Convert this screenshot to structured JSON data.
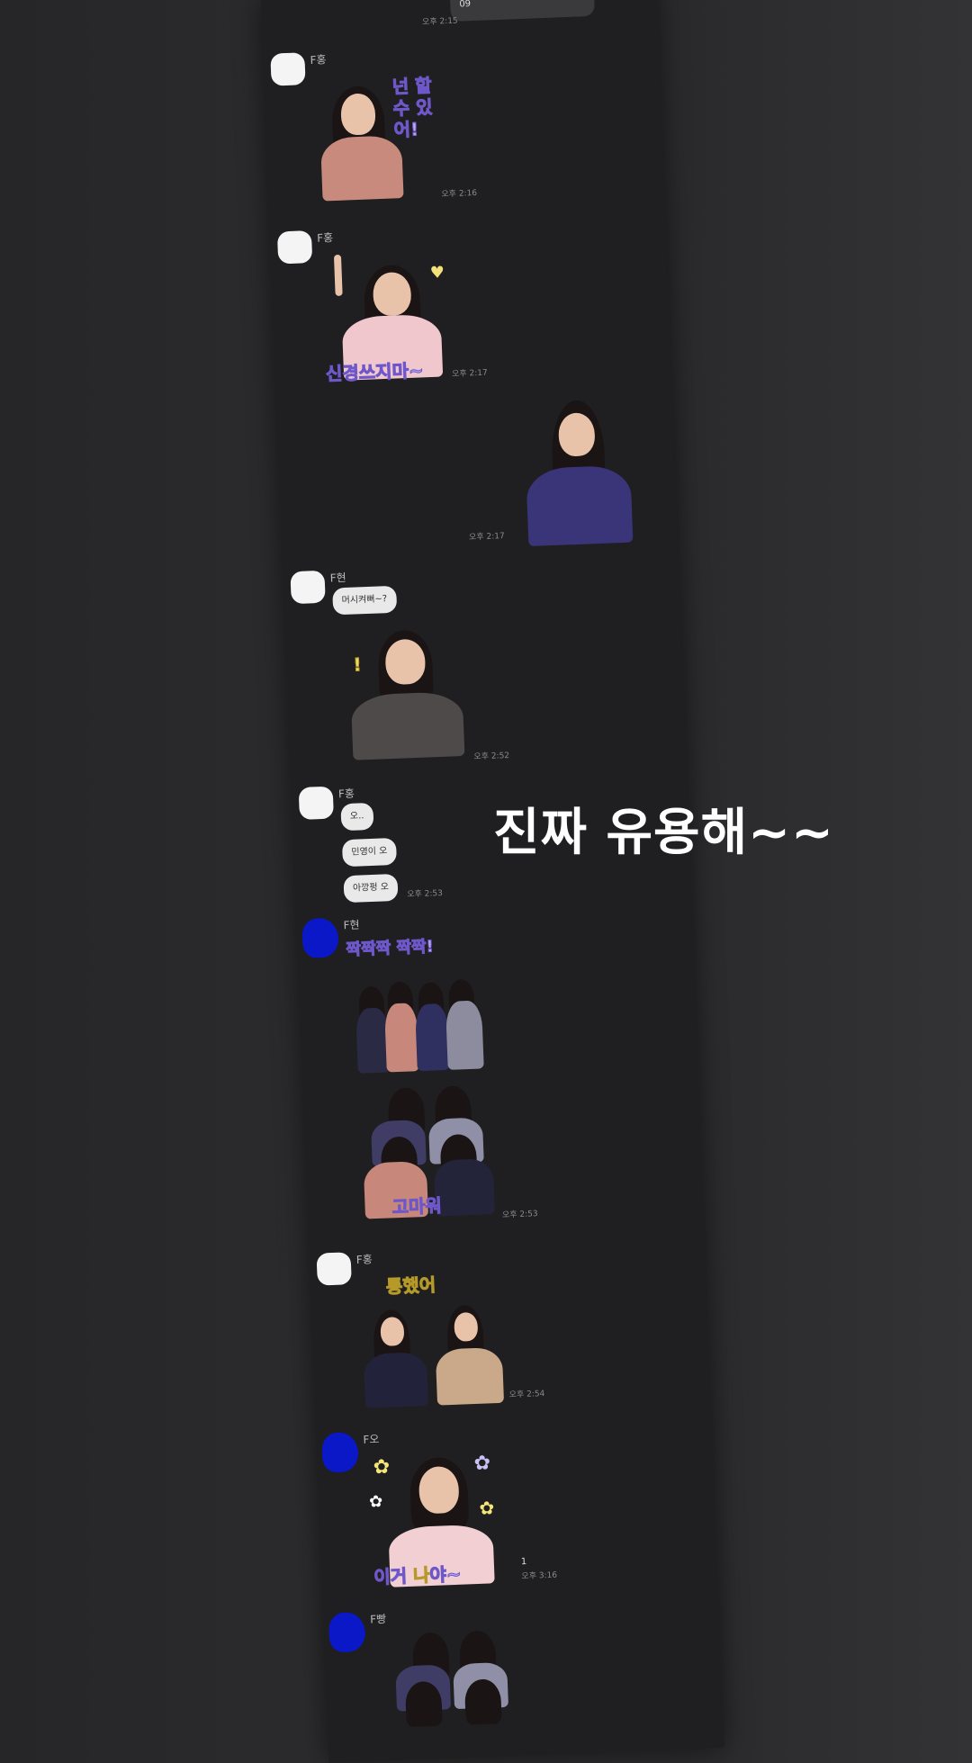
{
  "overlay": {
    "caption": "진짜 유용해~~"
  },
  "messages": [
    {
      "kind": "own_text",
      "text": "09",
      "time": "오후 2:15"
    },
    {
      "kind": "sticker",
      "sender": "F홍",
      "sticker_text": "넌 할수 있어!",
      "time": "오후 2:16"
    },
    {
      "kind": "sticker",
      "sender": "F홍",
      "sticker_text": "신경쓰지마~",
      "time": "오후 2:17"
    },
    {
      "kind": "own_sticker",
      "time": "오후 2:17"
    },
    {
      "kind": "text_sticker",
      "sender": "F현",
      "text": "머시켜뻐~?",
      "time": "오후 2:52"
    },
    {
      "kind": "texts",
      "sender": "F홍",
      "texts": [
        "오..",
        "민영이 오",
        "아깡펑 오"
      ],
      "time": "오후 2:53"
    },
    {
      "kind": "two_stickers",
      "sender": "F현",
      "sticker_text_1": "짝짝짝 짝짝!",
      "sticker_text_2": "고마워",
      "time": "오후 2:53"
    },
    {
      "kind": "sticker",
      "sender": "F홍",
      "sticker_text": "통했어",
      "time": "오후 2:54"
    },
    {
      "kind": "sticker",
      "sender": "F오",
      "sticker_text_a": "이거",
      "sticker_text_b": "나",
      "sticker_text_c": "야~",
      "unread": "1",
      "time": "오후 3:16"
    },
    {
      "kind": "sticker",
      "sender": "F빵"
    }
  ],
  "colors": {
    "panel": "#1f1f21",
    "bubble": "#e9e9e9",
    "purple_text": "#b9a8f0",
    "yellow_text": "#f1d86b",
    "blue_avatar": "#0a18c8"
  }
}
